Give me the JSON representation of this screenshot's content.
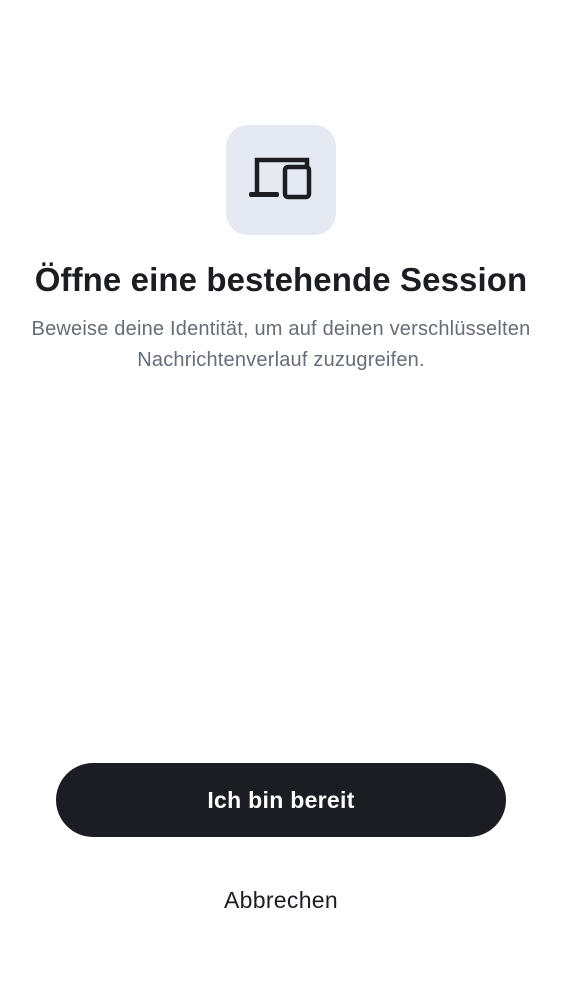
{
  "header": {
    "icon": "devices-icon",
    "icon_tile_color": "#e5e9f1",
    "title": "Öffne eine bestehende Session",
    "subtitle": "Beweise deine Identität, um auf deinen verschlüsselten Nachrichtenverlauf zuzugreifen."
  },
  "actions": {
    "primary_label": "Ich bin bereit",
    "secondary_label": "Abbrechen",
    "primary_color": "#1b1d22"
  }
}
